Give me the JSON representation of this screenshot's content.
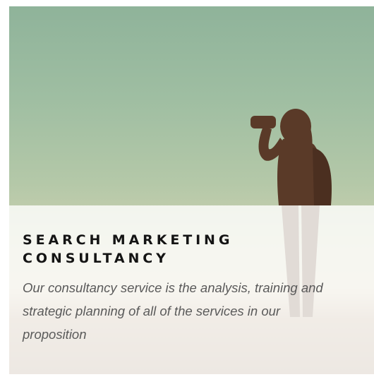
{
  "service_card": {
    "image_description_icon": "hiker-with-binoculars-silhouette",
    "title_line1": "SEARCH MARKETING",
    "title_line2": "CONSULTANCY",
    "description": "Our consultancy service is the analysis, training and strategic planning of all of the services in our proposition"
  }
}
